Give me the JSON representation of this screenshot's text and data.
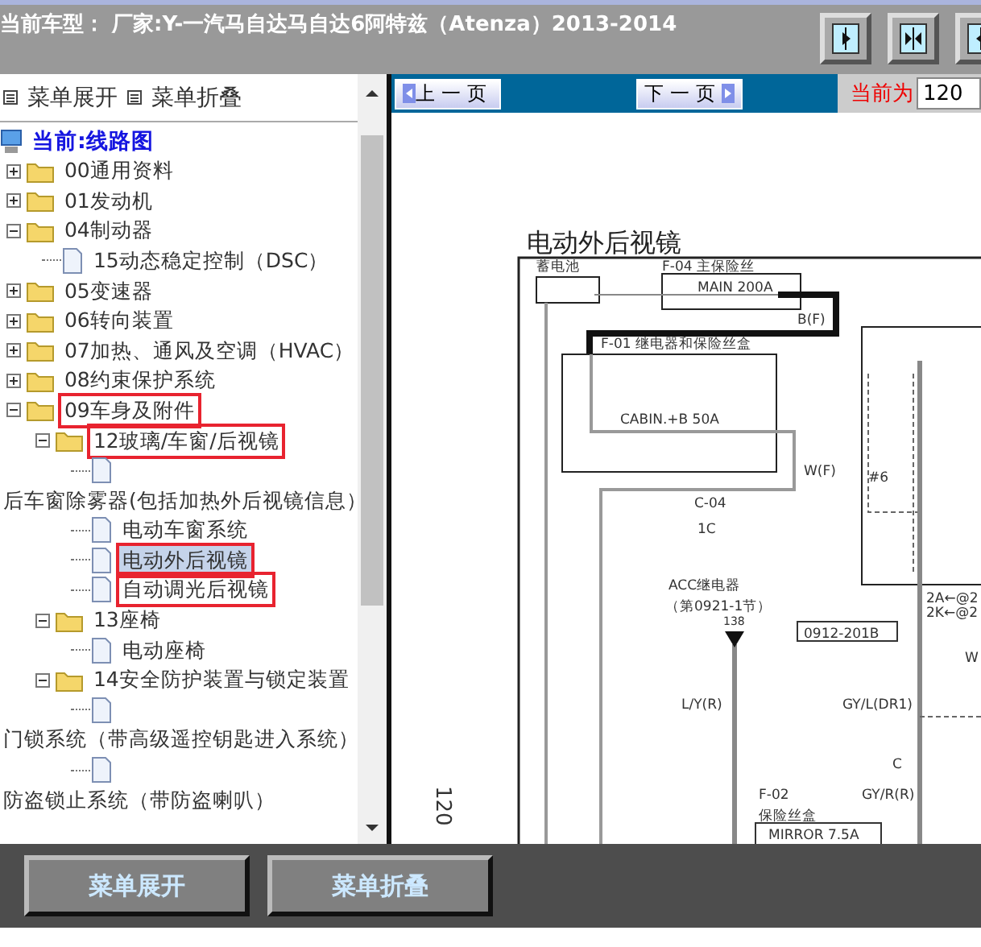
{
  "header": {
    "title": "当前车型： 厂家:Y-一汽马自达马自达6阿特兹（Atenza）2013-2014"
  },
  "menu_links": [
    "菜单展开",
    "菜单折叠"
  ],
  "tree": [
    {
      "kind": "root",
      "label": "当前:线路图"
    },
    {
      "kind": "folder",
      "label": "00通用资料",
      "expanded": false
    },
    {
      "kind": "folder",
      "label": "01发动机",
      "expanded": false
    },
    {
      "kind": "folder",
      "label": "04制动器",
      "expanded": true,
      "children": [
        {
          "kind": "doc",
          "label": "15动态稳定控制（DSC）",
          "selected": false
        }
      ]
    },
    {
      "kind": "folder",
      "label": "05变速器",
      "expanded": false
    },
    {
      "kind": "folder",
      "label": "06转向装置",
      "expanded": false
    },
    {
      "kind": "folder",
      "label": "07加热、通风及空调（HVAC）",
      "expanded": false
    },
    {
      "kind": "folder",
      "label": "08约束保护系统",
      "expanded": false
    },
    {
      "kind": "folder",
      "label": "09车身及附件",
      "expanded": true,
      "highlighted": true,
      "children": [
        {
          "kind": "folder",
          "label": "12玻璃/车窗/后视镜",
          "expanded": true,
          "highlighted": true,
          "children": [
            {
              "kind": "doc",
              "label": "后车窗除雾器(包括加热外后视镜信息）",
              "selected": false
            },
            {
              "kind": "doc",
              "label": "电动车窗系统",
              "selected": false
            },
            {
              "kind": "doc",
              "label": "电动外后视镜",
              "selected": true,
              "highlighted": true
            },
            {
              "kind": "doc",
              "label": "自动调光后视镜",
              "selected": false,
              "highlighted": true
            }
          ]
        },
        {
          "kind": "folder",
          "label": "13座椅",
          "expanded": true,
          "children": [
            {
              "kind": "doc",
              "label": "电动座椅",
              "selected": false
            }
          ]
        },
        {
          "kind": "folder",
          "label": "14安全防护装置与锁定装置",
          "expanded": true,
          "children": [
            {
              "kind": "doc",
              "label": "门锁系统（带高级遥控钥匙进入系统）",
              "selected": false
            },
            {
              "kind": "doc",
              "label": "防盗锁止系统（带防盗喇叭）",
              "selected": false
            }
          ]
        }
      ]
    }
  ],
  "pager": {
    "prev": "上一页",
    "next": "下一页",
    "current_label": "当前为",
    "current_value": "120"
  },
  "diagram": {
    "title": "电动外后视镜",
    "page_number": "120",
    "labels": [
      "蓄电池",
      "F-04 主保险丝",
      "MAIN 200A",
      "B(F)",
      "F-01 继电器和保险丝盒",
      "CABIN.+B 50A",
      "W(F)",
      "C-04",
      "1C",
      "#6",
      "ACC继电器",
      "（第0921-1节）",
      "138",
      "0912-201B",
      "2A←@2",
      "2K←@2",
      "W",
      "L/Y(R)",
      "GY/L(DR1)",
      "C",
      "F-02",
      "GY/R(R)",
      "保险丝盒",
      "MIRROR 7.5A"
    ]
  },
  "footer_buttons": [
    "菜单展开",
    "菜单折叠"
  ]
}
